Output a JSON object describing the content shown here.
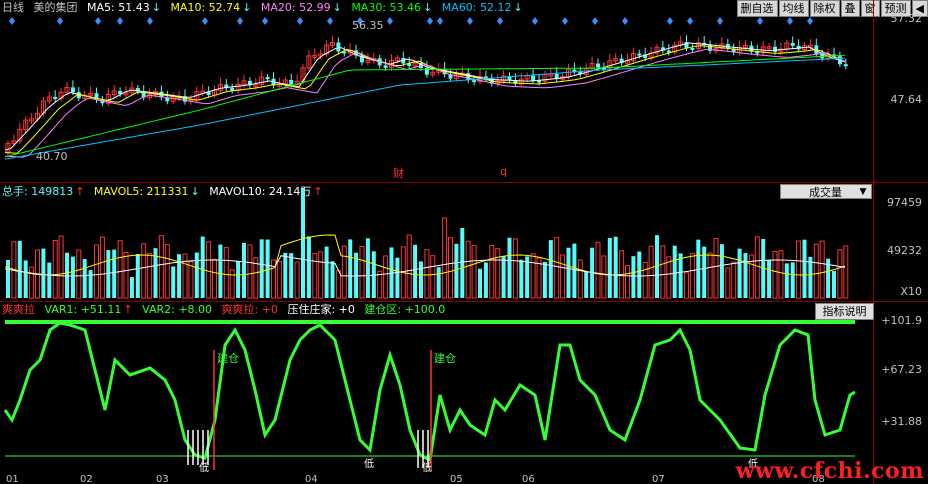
{
  "header": {
    "period": "日线",
    "stock": "美的集团",
    "ma5": "MA5: 51.43",
    "ma10": "MA10: 52.74",
    "ma20": "MA20: 52.99",
    "ma30": "MA30: 53.46",
    "ma60": "MA60: 52.12",
    "arrow_down": "↓",
    "arrow_up": "↑"
  },
  "toolbar": {
    "b1": "删自选",
    "b2": "均线",
    "b3": "除权",
    "b4": "叠",
    "b5": "窗",
    "b6": "预测",
    "back": "◀"
  },
  "price_axis": {
    "top": "57.32",
    "mid": "47.64"
  },
  "price_annotations": {
    "high": "56.35",
    "low": "40.70",
    "cai": "财",
    "q": "q"
  },
  "volume_header": {
    "total": "总手: 149813",
    "mavol5": "MAVOL5: 211331",
    "mavol10": "MAVOL10: 24.14万"
  },
  "volume_dropdown": "成交量",
  "volume_axis": {
    "top": "97459",
    "mid": "49232",
    "unit": "X10"
  },
  "indicator_header": {
    "name": "爽爽拉",
    "var1": "VAR1: +51.11",
    "var2": "VAR2: +8.00",
    "sslq": "爽爽拉: +0",
    "yzzj": "压住庄家: +0",
    "jcq": "建仓区: +100.0"
  },
  "indicator_help": "指标说明",
  "indicator_axis": {
    "top": "+101.9",
    "mid": "+67.23",
    "low": "+31.88"
  },
  "indicator_annotations": {
    "jiancang": "建仓",
    "di": "低"
  },
  "months": [
    "01",
    "02",
    "03",
    "04",
    "05",
    "06",
    "07",
    "08"
  ],
  "colors": {
    "ma5": "#ffffff",
    "ma10": "#ffff00",
    "ma20": "#ff80ff",
    "ma30": "#00ff00",
    "ma60": "#00c0ff",
    "up": "#ff3232",
    "down": "#54fcfc",
    "indicator": "#33ff33"
  },
  "watermark": "www.cfchi.com"
}
